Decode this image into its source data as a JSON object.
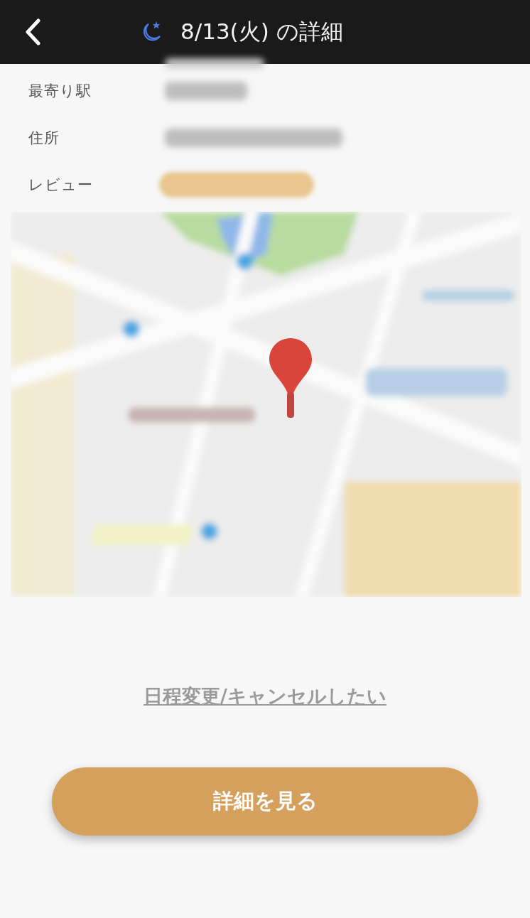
{
  "header": {
    "title": "8/13(火) の詳細"
  },
  "info_rows": [
    {
      "label": "最寄り駅",
      "kind": "text"
    },
    {
      "label": "住所",
      "kind": "text"
    },
    {
      "label": "レビュー",
      "kind": "rating"
    }
  ],
  "change_link": "日程変更/キャンセルしたい",
  "details_button": "詳細を見る"
}
